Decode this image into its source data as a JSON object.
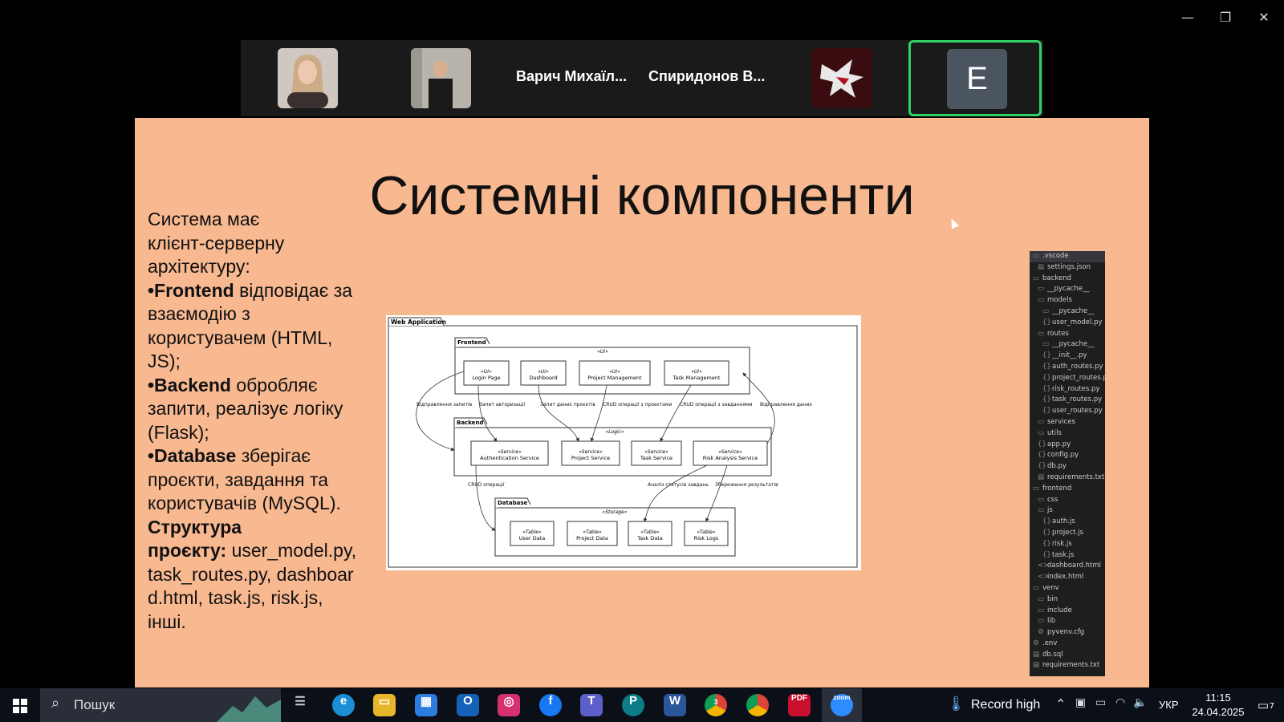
{
  "window": {
    "minimize": "—",
    "restore": "❐",
    "close": "✕"
  },
  "participants": {
    "name1": "Варич Михаїл...",
    "name2": "Спиридонов В...",
    "active_initial": "E"
  },
  "slide": {
    "title": "Системні компоненти",
    "l1": "Система має",
    "l2": "клієнт-серверну",
    "l3": "архітектуру:",
    "fe_b": "•Frontend",
    "fe_t": " відповідає за",
    "l5": "взаємодію з",
    "l6": "користувачем (HTML,",
    "l7": "JS);",
    "be_b": "•Backend",
    "be_t": " обробляє",
    "l9": "запити, реалізує логіку",
    "l10": "(Flask);",
    "db_b": "•Database",
    "db_t": " зберігає",
    "l12": "проєкти, завдання та",
    "l13": "користувачів (MySQL).",
    "st_b1": "Структура",
    "st_b2": "проєкту:",
    "st_t": " user_model.py,",
    "l16": " task_routes.py, dashboar",
    "l17": "d.html, task.js, risk.js,",
    "l18": "інші."
  },
  "diagram": {
    "web": "Web Application",
    "frontend": "Frontend",
    "backend": "Backend",
    "database": "Database",
    "ui": "«UI»",
    "logic": "«Logic»",
    "storage": "«Storage»",
    "ui_st": "«UI»",
    "svc_st": "«Service»",
    "tbl_st": "«Table»",
    "login": "Login Page",
    "dashboard": "Dashboard",
    "pm": "Project Management",
    "tm": "Task Management",
    "auth": "Authentication Service",
    "proj": "Project Service",
    "task": "Task Service",
    "risk": "Risk Analysis Service",
    "user_data": "User Data",
    "project_data": "Project Data",
    "task_data": "Task Data",
    "risk_logs": "Risk Logs",
    "e1": "Відправлення запитів",
    "e2": "Запит авторизації",
    "e3": "Запит даних проєктів",
    "e4": "CRUD операції з проєктами",
    "e5": "CRUD операції з завданнями",
    "e6": "Відправлення даних",
    "e7": "CRUD операції",
    "e8": "Аналіз статусів завдань",
    "e9": "Збереження результатів"
  },
  "tree": [
    {
      "icon": "▭",
      "label": ".vscode",
      "d": 0
    },
    {
      "icon": "▤",
      "label": "settings.json",
      "d": 1
    },
    {
      "icon": "▭",
      "label": "backend",
      "d": 0
    },
    {
      "icon": "▭",
      "label": "__pycache__",
      "d": 1
    },
    {
      "icon": "▭",
      "label": "models",
      "d": 1
    },
    {
      "icon": "▭",
      "label": "__pycache__",
      "d": 2
    },
    {
      "icon": "{}",
      "label": "user_model.py",
      "d": 2
    },
    {
      "icon": "▭",
      "label": "routes",
      "d": 1
    },
    {
      "icon": "▭",
      "label": "__pycache__",
      "d": 2
    },
    {
      "icon": "{}",
      "label": "__init__.py",
      "d": 2
    },
    {
      "icon": "{}",
      "label": "auth_routes.py",
      "d": 2
    },
    {
      "icon": "{}",
      "label": "project_routes.py",
      "d": 2
    },
    {
      "icon": "{}",
      "label": "risk_routes.py",
      "d": 2
    },
    {
      "icon": "{}",
      "label": "task_routes.py",
      "d": 2
    },
    {
      "icon": "{}",
      "label": "user_routes.py",
      "d": 2
    },
    {
      "icon": "▭",
      "label": "services",
      "d": 1
    },
    {
      "icon": "▭",
      "label": "utils",
      "d": 1
    },
    {
      "icon": "{}",
      "label": "app.py",
      "d": 1
    },
    {
      "icon": "{}",
      "label": "config.py",
      "d": 1
    },
    {
      "icon": "{}",
      "label": "db.py",
      "d": 1
    },
    {
      "icon": "▤",
      "label": "requirements.txt",
      "d": 1
    },
    {
      "icon": "▭",
      "label": "frontend",
      "d": 0
    },
    {
      "icon": "▭",
      "label": "css",
      "d": 1
    },
    {
      "icon": "▭",
      "label": "js",
      "d": 1
    },
    {
      "icon": "{}",
      "label": "auth.js",
      "d": 2
    },
    {
      "icon": "{}",
      "label": "project.js",
      "d": 2
    },
    {
      "icon": "{}",
      "label": "risk.js",
      "d": 2
    },
    {
      "icon": "{}",
      "label": "task.js",
      "d": 2
    },
    {
      "icon": "<>",
      "label": "dashboard.html",
      "d": 1
    },
    {
      "icon": "<>",
      "label": "index.html",
      "d": 1
    },
    {
      "icon": "▭",
      "label": "venv",
      "d": 0
    },
    {
      "icon": "▭",
      "label": "bin",
      "d": 1
    },
    {
      "icon": "▭",
      "label": "include",
      "d": 1
    },
    {
      "icon": "▭",
      "label": "lib",
      "d": 1
    },
    {
      "icon": "⚙",
      "label": "pyvenv.cfg",
      "d": 1
    },
    {
      "icon": "⚙",
      "label": ".env",
      "d": 0
    },
    {
      "icon": "▤",
      "label": "db.sql",
      "d": 0
    },
    {
      "icon": "▤",
      "label": "requirements.txt",
      "d": 0
    }
  ],
  "taskbar": {
    "search": "Пошук",
    "record": "Record high",
    "lang": "УКР",
    "time": "11:15",
    "date": "24.04.2025",
    "notif": "7",
    "badge1": "3"
  }
}
